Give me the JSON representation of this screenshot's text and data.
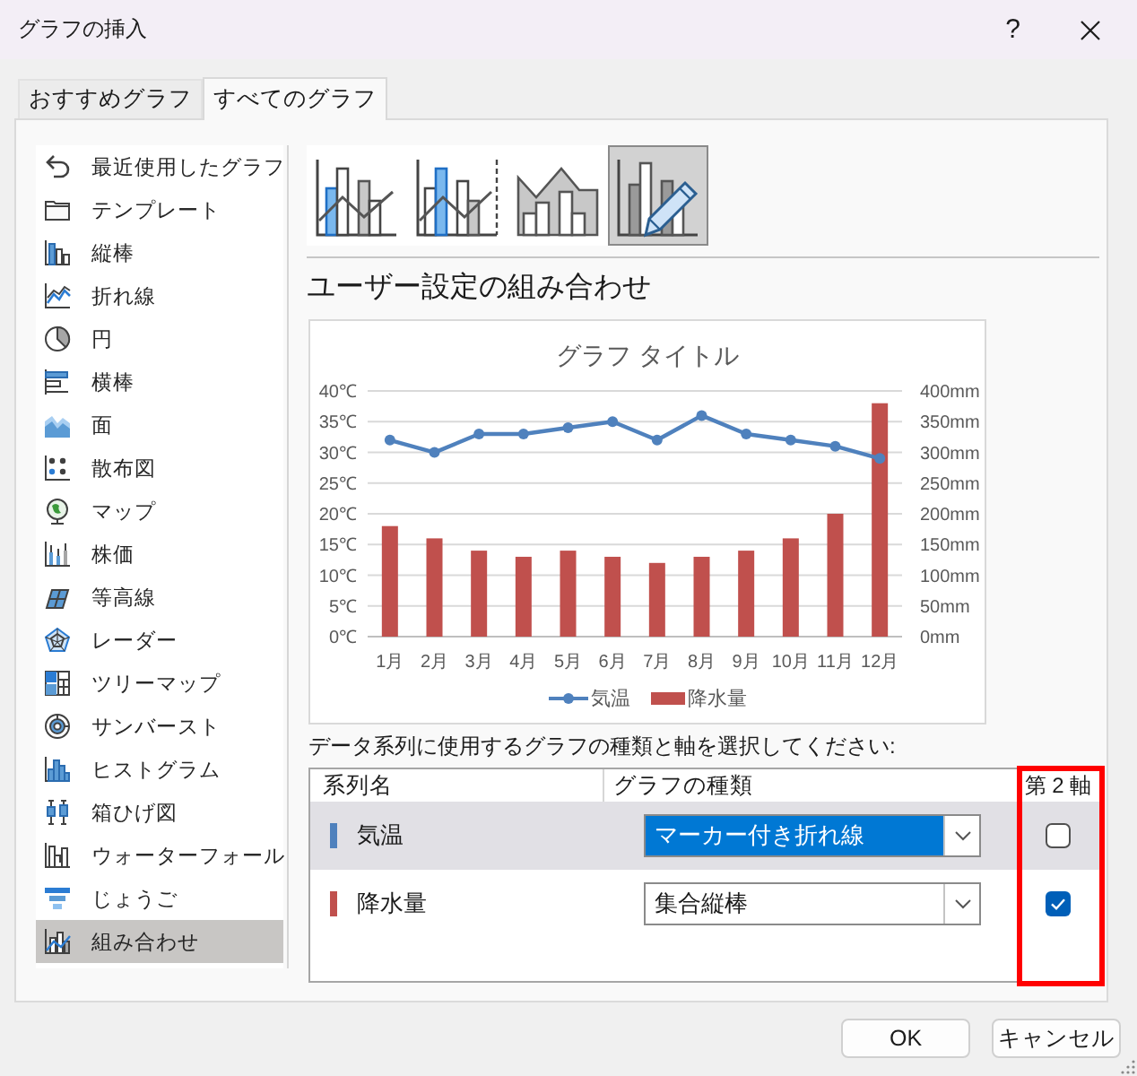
{
  "window": {
    "title": "グラフの挿入",
    "help": "?"
  },
  "tabs": [
    {
      "label": "おすすめグラフ",
      "selected": false
    },
    {
      "label": "すべてのグラフ",
      "selected": true
    }
  ],
  "sidebar": {
    "items": [
      {
        "label": "最近使用したグラフ",
        "selected": false
      },
      {
        "label": "テンプレート",
        "selected": false
      },
      {
        "label": "縦棒",
        "selected": false
      },
      {
        "label": "折れ線",
        "selected": false
      },
      {
        "label": "円",
        "selected": false
      },
      {
        "label": "横棒",
        "selected": false
      },
      {
        "label": "面",
        "selected": false
      },
      {
        "label": "散布図",
        "selected": false
      },
      {
        "label": "マップ",
        "selected": false
      },
      {
        "label": "株価",
        "selected": false
      },
      {
        "label": "等高線",
        "selected": false
      },
      {
        "label": "レーダー",
        "selected": false
      },
      {
        "label": "ツリーマップ",
        "selected": false
      },
      {
        "label": "サンバースト",
        "selected": false
      },
      {
        "label": "ヒストグラム",
        "selected": false
      },
      {
        "label": "箱ひげ図",
        "selected": false
      },
      {
        "label": "ウォーターフォール",
        "selected": false
      },
      {
        "label": "じょうご",
        "selected": false
      },
      {
        "label": "組み合わせ",
        "selected": true
      }
    ]
  },
  "subtypes": [
    {
      "selected": false
    },
    {
      "selected": false
    },
    {
      "selected": false
    },
    {
      "selected": true
    }
  ],
  "heading": "ユーザー設定の組み合わせ",
  "preview": {
    "chart_data": {
      "type": "bar",
      "title": "グラフ タイトル",
      "categories": [
        "1月",
        "2月",
        "3月",
        "4月",
        "5月",
        "6月",
        "7月",
        "8月",
        "9月",
        "10月",
        "11月",
        "12月"
      ],
      "series": [
        {
          "name": "気温",
          "color": "#4f81bd",
          "type": "line",
          "marker": "circle",
          "values": [
            32,
            30,
            33,
            33,
            34,
            35,
            32,
            36,
            33,
            32,
            31,
            29
          ]
        },
        {
          "name": "降水量",
          "color": "#c0504d",
          "axis": "y2",
          "values": [
            180,
            160,
            140,
            130,
            140,
            130,
            120,
            130,
            140,
            160,
            200,
            380
          ]
        }
      ],
      "ylim": [
        0,
        40
      ],
      "yticks": [
        {
          "value": 0,
          "label": "0℃"
        },
        {
          "value": 5,
          "label": "5℃"
        },
        {
          "value": 10,
          "label": "10℃"
        },
        {
          "value": 15,
          "label": "15℃"
        },
        {
          "value": 20,
          "label": "20℃"
        },
        {
          "value": 25,
          "label": "25℃"
        },
        {
          "value": 30,
          "label": "30℃"
        },
        {
          "value": 35,
          "label": "35℃"
        },
        {
          "value": 40,
          "label": "40℃"
        }
      ],
      "y2lim": [
        0,
        400
      ],
      "y2ticks": [
        {
          "value": 0,
          "label": "0mm"
        },
        {
          "value": 50,
          "label": "50mm"
        },
        {
          "value": 100,
          "label": "100mm"
        },
        {
          "value": 150,
          "label": "150mm"
        },
        {
          "value": 200,
          "label": "200mm"
        },
        {
          "value": 250,
          "label": "250mm"
        },
        {
          "value": 300,
          "label": "300mm"
        },
        {
          "value": 350,
          "label": "350mm"
        },
        {
          "value": 400,
          "label": "400mm"
        }
      ],
      "grid": true,
      "legend": "bottom"
    }
  },
  "instruction": "データ系列に使用するグラフの種類と軸を選択してください:",
  "series_table": {
    "columns": [
      {
        "label": "系列名",
        "highlighted": false
      },
      {
        "label": "グラフの種類",
        "highlighted": false
      },
      {
        "label": "第 2 軸",
        "highlighted": true
      }
    ],
    "rows": [
      {
        "name": "気温",
        "color": "#4f81bd",
        "chart_type": "マーカー付き折れ線",
        "secondary_axis": false,
        "selected": true
      },
      {
        "name": "降水量",
        "color": "#c0504d",
        "chart_type": "集合縦棒",
        "secondary_axis": true,
        "selected": false
      }
    ]
  },
  "buttons": [
    "OK",
    "キャンセル"
  ]
}
